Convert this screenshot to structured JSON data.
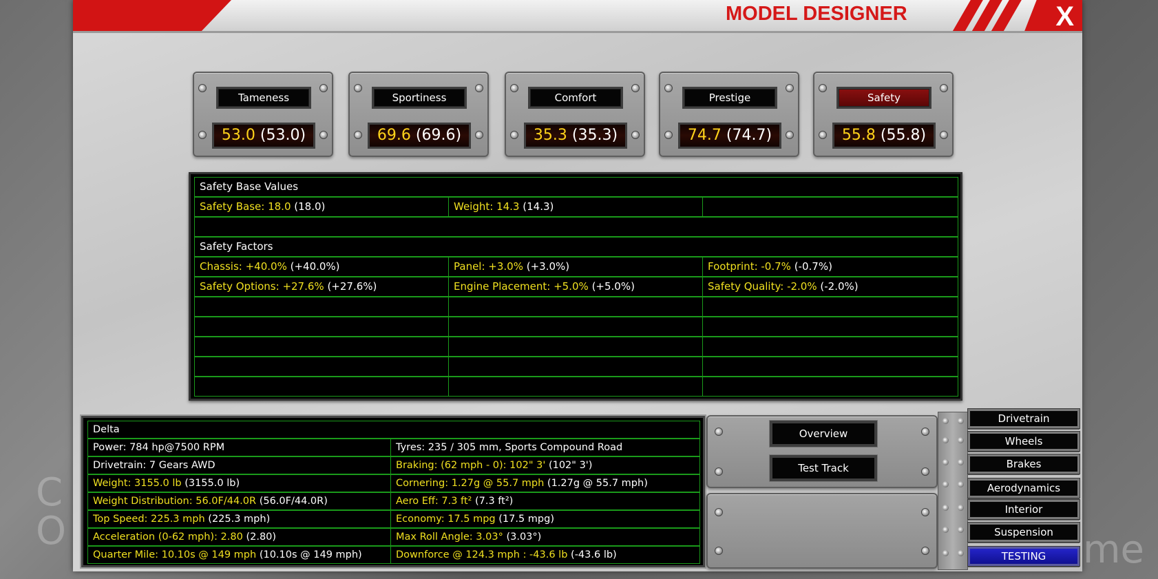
{
  "background": {
    "left_text": [
      "C",
      "O"
    ],
    "right_text": "me"
  },
  "window": {
    "title": "MODEL DESIGNER",
    "close_label": "X"
  },
  "ratings": [
    {
      "label": "Tameness",
      "value": "53.0",
      "base": "(53.0)",
      "active": false
    },
    {
      "label": "Sportiness",
      "value": "69.6",
      "base": "(69.6)",
      "active": false
    },
    {
      "label": "Comfort",
      "value": "35.3",
      "base": "(35.3)",
      "active": false
    },
    {
      "label": "Prestige",
      "value": "74.7",
      "base": "(74.7)",
      "active": false
    },
    {
      "label": "Safety",
      "value": "55.8",
      "base": "(55.8)",
      "active": true
    }
  ],
  "safety_grid": {
    "base_header": "Safety Base Values",
    "base_row": [
      {
        "label": "Safety Base: 18.0",
        "orig": "(18.0)"
      },
      {
        "label": "Weight: 14.3",
        "orig": "(14.3)"
      },
      {
        "label": "",
        "orig": ""
      }
    ],
    "factors_header": "Safety Factors",
    "factor_rows": [
      [
        {
          "label": "Chassis: +40.0%",
          "orig": "(+40.0%)"
        },
        {
          "label": "Panel: +3.0%",
          "orig": "(+3.0%)"
        },
        {
          "label": "Footprint: -0.7%",
          "orig": "(-0.7%)"
        }
      ],
      [
        {
          "label": "Safety Options: +27.6%",
          "orig": "(+27.6%)"
        },
        {
          "label": "Engine Placement: +5.0%",
          "orig": "(+5.0%)"
        },
        {
          "label": "Safety Quality: -2.0%",
          "orig": "(-2.0%)"
        }
      ]
    ]
  },
  "delta": {
    "title": "Delta",
    "rows": [
      [
        {
          "label": "Power: 784 hp@7500 RPM",
          "orig": "",
          "hl": false
        },
        {
          "label": "Tyres: 235 / 305 mm, Sports Compound Road",
          "orig": "",
          "hl": false
        }
      ],
      [
        {
          "label": "Drivetrain: 7 Gears AWD",
          "orig": "",
          "hl": false
        },
        {
          "label": "Braking: (62 mph - 0): 102\" 3'",
          "orig": "(102\" 3')",
          "hl": true
        }
      ],
      [
        {
          "label": "Weight: 3155.0 lb",
          "orig": "(3155.0 lb)",
          "hl": true
        },
        {
          "label": "Cornering: 1.27g @ 55.7 mph",
          "orig": "(1.27g @ 55.7 mph)",
          "hl": true
        }
      ],
      [
        {
          "label": "Weight Distribution: 56.0F/44.0R",
          "orig": "(56.0F/44.0R)",
          "hl": true
        },
        {
          "label": "Aero Eff: 7.3 ft²",
          "orig": "(7.3 ft²)",
          "hl": true
        }
      ],
      [
        {
          "label": "Top Speed: 225.3 mph",
          "orig": "(225.3 mph)",
          "hl": true
        },
        {
          "label": "Economy: 17.5 mpg",
          "orig": "(17.5 mpg)",
          "hl": true
        }
      ],
      [
        {
          "label": "Acceleration (0-62 mph): 2.80",
          "orig": "(2.80)",
          "hl": true
        },
        {
          "label": "Max Roll Angle: 3.03°",
          "orig": "(3.03°)",
          "hl": true
        }
      ],
      [
        {
          "label": "Quarter Mile: 10.10s @ 149 mph",
          "orig": "(10.10s @ 149 mph)",
          "hl": true
        },
        {
          "label": "Downforce @ 124.3 mph : -43.6 lb",
          "orig": "(-43.6 lb)",
          "hl": true
        }
      ]
    ]
  },
  "actions": {
    "overview": "Overview",
    "test_track": "Test Track"
  },
  "nav": [
    {
      "label": "Drivetrain",
      "active": false
    },
    {
      "label": "Wheels",
      "active": false
    },
    {
      "label": "Brakes",
      "active": false
    },
    {
      "label": "Aerodynamics",
      "active": false
    },
    {
      "label": "Interior",
      "active": false
    },
    {
      "label": "Suspension",
      "active": false
    },
    {
      "label": "TESTING",
      "active": true
    }
  ],
  "colors": {
    "title_red": "#d21414",
    "value_yellow": "#ffd21a",
    "grid_green": "#1a9a1a",
    "active_nav_blue": "#2424c8"
  }
}
